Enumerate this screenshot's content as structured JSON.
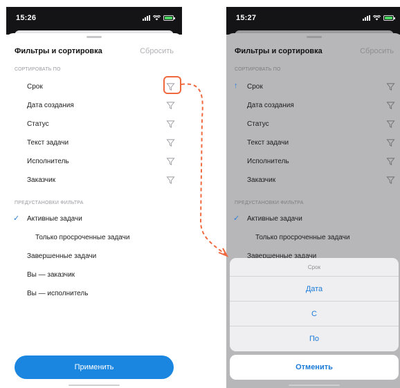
{
  "left_screen": {
    "status_time": "15:26",
    "sheet_title": "Фильтры и сортировка",
    "reset_label": "Сбросить",
    "sort_section_label": "СОРТИРОВАТЬ ПО",
    "sort_items": [
      {
        "label": "Срок"
      },
      {
        "label": "Дата создания"
      },
      {
        "label": "Статус"
      },
      {
        "label": "Текст задачи"
      },
      {
        "label": "Исполнитель"
      },
      {
        "label": "Заказчик"
      }
    ],
    "preset_section_label": "ПРЕДУСТАНОВКИ ФИЛЬТРА",
    "preset_items": [
      {
        "label": "Активные задачи",
        "checked": true
      },
      {
        "label": "Только просроченные задачи"
      },
      {
        "label": "Завершенные задачи"
      },
      {
        "label": "Вы — заказчик"
      },
      {
        "label": "Вы — исполнитель"
      }
    ],
    "apply_label": "Применить"
  },
  "right_screen": {
    "status_time": "15:27",
    "sheet_title": "Фильтры и сортировка",
    "reset_label": "Сбросить",
    "sort_section_label": "СОРТИРОВАТЬ ПО",
    "sort_items": [
      {
        "label": "Срок",
        "sorted": true
      },
      {
        "label": "Дата создания"
      },
      {
        "label": "Статус"
      },
      {
        "label": "Текст задачи"
      },
      {
        "label": "Исполнитель"
      },
      {
        "label": "Заказчик"
      }
    ],
    "preset_section_label": "ПРЕДУСТАНОВКИ ФИЛЬТРА",
    "preset_items": [
      {
        "label": "Активные задачи",
        "checked": true
      },
      {
        "label": "Только просроченные задачи"
      },
      {
        "label": "Завершенные задачи"
      }
    ],
    "action_sheet": {
      "title": "Срок",
      "options": [
        "Дата",
        "С",
        "По"
      ],
      "cancel_label": "Отменить"
    }
  },
  "icons": {
    "funnel": "funnel-icon",
    "sort_arrow": "arrow-up-icon",
    "check": "checkmark-icon"
  },
  "colors": {
    "accent": "#1a86e0",
    "annotation": "#f0683d",
    "dim_overlay": "#b7b7b9"
  }
}
